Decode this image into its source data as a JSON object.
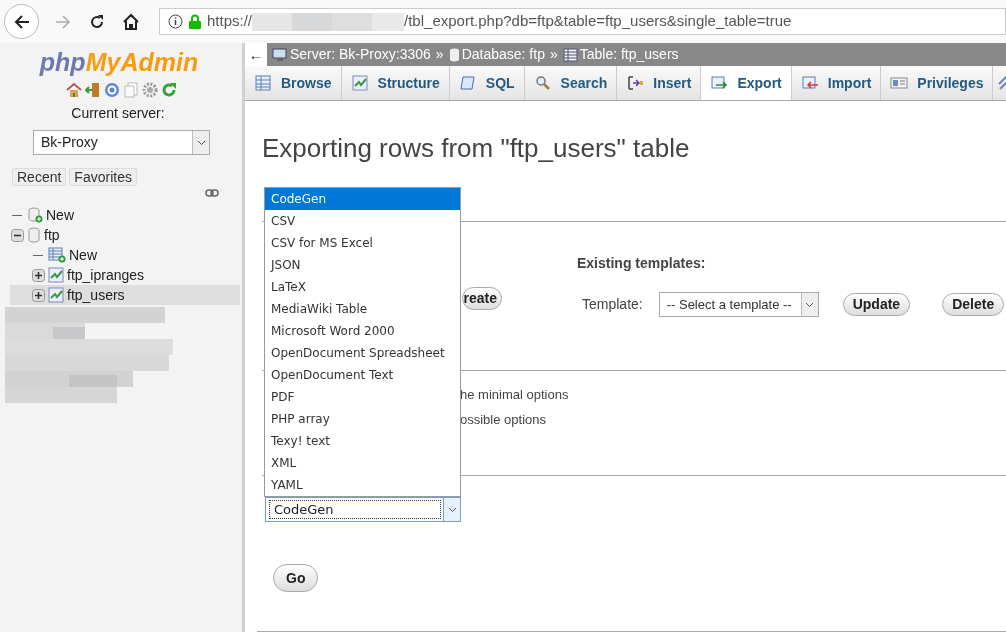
{
  "browser": {
    "url_prefix": "https://",
    "url_suffix": "/tbl_export.php?db=ftp&table=ftp_users&single_table=true"
  },
  "sidebar": {
    "logo_a": "php",
    "logo_b": "MyAdmin",
    "server_label": "Current server:",
    "server_value": "Bk-Proxy",
    "buttons": [
      "Recent",
      "Favorites"
    ],
    "tree": [
      {
        "label": "New",
        "kind": "new-db",
        "highlighted": false
      },
      {
        "label": "ftp",
        "kind": "db",
        "expanded": true,
        "highlighted": false,
        "children": [
          {
            "label": "New",
            "kind": "new-table",
            "highlighted": false
          },
          {
            "label": "ftp_ipranges",
            "kind": "table",
            "expanded": false,
            "highlighted": false
          },
          {
            "label": "ftp_users",
            "kind": "table",
            "expanded": false,
            "highlighted": true
          }
        ]
      }
    ]
  },
  "breadcrumb": {
    "back": "←",
    "items": [
      {
        "kind": "server",
        "label": "Server: Bk-Proxy:3306"
      },
      {
        "kind": "database",
        "label": "Database: ftp"
      },
      {
        "kind": "table",
        "label": "Table: ftp_users"
      }
    ],
    "separator": "»"
  },
  "tabs": [
    {
      "label": "Browse",
      "kind": "browse",
      "selected": false
    },
    {
      "label": "Structure",
      "kind": "structure",
      "selected": false
    },
    {
      "label": "SQL",
      "kind": "sql",
      "selected": false
    },
    {
      "label": "Search",
      "kind": "search",
      "selected": false
    },
    {
      "label": "Insert",
      "kind": "insert",
      "selected": false
    },
    {
      "label": "Export",
      "kind": "export",
      "selected": true
    },
    {
      "label": "Import",
      "kind": "import",
      "selected": false
    },
    {
      "label": "Privileges",
      "kind": "privileges",
      "selected": false
    }
  ],
  "title": "Exporting rows from \"ftp_users\" table",
  "templates": {
    "create_button": "reate",
    "existing_heading": "Existing templates:",
    "template_label": "Template:",
    "template_select": "-- Select a template --",
    "buttons": [
      "Update",
      "Delete"
    ]
  },
  "method": {
    "options": [
      "he minimal options",
      "ossible options"
    ]
  },
  "format": {
    "value": "CodeGen",
    "go_button": "Go",
    "options": [
      {
        "label": "CodeGen",
        "selected": true
      },
      {
        "label": "CSV",
        "selected": false
      },
      {
        "label": "CSV for MS Excel",
        "selected": false
      },
      {
        "label": "JSON",
        "selected": false
      },
      {
        "label": "LaTeX",
        "selected": false
      },
      {
        "label": "MediaWiki Table",
        "selected": false
      },
      {
        "label": "Microsoft Word 2000",
        "selected": false
      },
      {
        "label": "OpenDocument Spreadsheet",
        "selected": false
      },
      {
        "label": "OpenDocument Text",
        "selected": false
      },
      {
        "label": "PDF",
        "selected": false
      },
      {
        "label": "PHP array",
        "selected": false
      },
      {
        "label": "Texy! text",
        "selected": false
      },
      {
        "label": "XML",
        "selected": false
      },
      {
        "label": "YAML",
        "selected": false
      }
    ]
  }
}
